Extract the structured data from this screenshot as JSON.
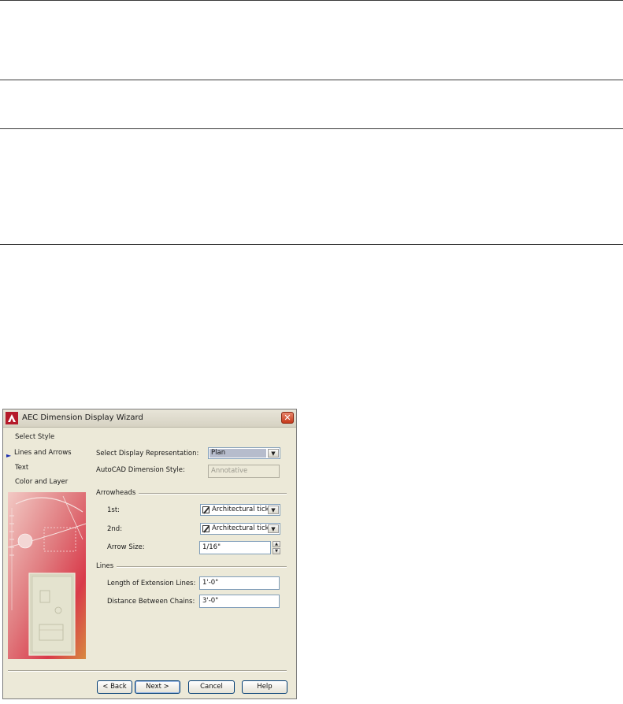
{
  "dialog": {
    "title": "AEC Dimension Display Wizard",
    "close_label": "✕"
  },
  "steps": [
    {
      "label": "Select Style",
      "active": false
    },
    {
      "label": "Lines and Arrows",
      "active": true
    },
    {
      "label": "Text",
      "active": false
    },
    {
      "label": "Color and Layer",
      "active": false
    }
  ],
  "step_marker": "►",
  "display_rep": {
    "label": "Select Display Representation:",
    "value": "Plan"
  },
  "dim_style": {
    "label": "AutoCAD Dimension Style:",
    "value": "Annotative"
  },
  "arrowheads": {
    "section": "Arrowheads",
    "first_label": "1st:",
    "first_value": "Architectural tick",
    "second_label": "2nd:",
    "second_value": "Architectural tick",
    "size_label": "Arrow Size:",
    "size_value": "1/16\""
  },
  "lines": {
    "section": "Lines",
    "ext_label": "Length of Extension Lines:",
    "ext_value": "1'-0\"",
    "chain_label": "Distance Between Chains:",
    "chain_value": "3'-0\""
  },
  "buttons": {
    "back": "< Back",
    "next": "Next >",
    "cancel": "Cancel",
    "help": "Help"
  },
  "dropdown_glyph": "▼",
  "spin_up": "▲",
  "spin_down": "▼"
}
